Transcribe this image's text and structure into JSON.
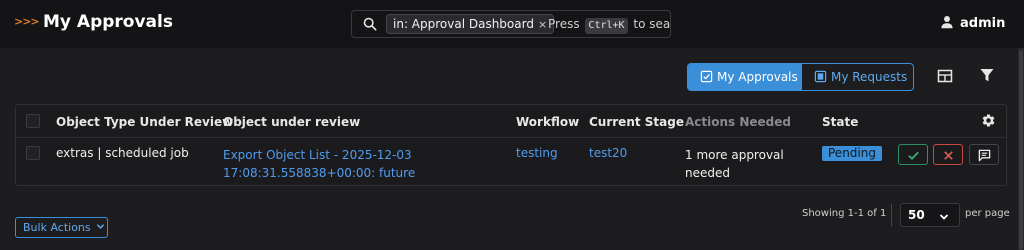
{
  "header": {
    "breadcrumb_chevrons": ">>>",
    "title": "My Approvals",
    "search": {
      "chip_label": "in: Approval Dashboard",
      "chip_close": "×",
      "hint_prefix": "Press",
      "shortcut": "Ctrl+K",
      "hint_suffix": "to search"
    },
    "user": {
      "name": "admin",
      "icon": "user-icon"
    }
  },
  "toolbar": {
    "tabs": [
      {
        "label": "My Approvals",
        "icon": "checklist-icon",
        "active": true
      },
      {
        "label": "My Requests",
        "icon": "request-icon",
        "active": false
      }
    ],
    "layout_icon": "layout-icon",
    "filter_icon": "filter-icon"
  },
  "table": {
    "columns": [
      "Object Type Under Review",
      "Object under review",
      "Workflow",
      "Current Stage",
      "Actions Needed",
      "State"
    ],
    "rows": [
      {
        "object_type": "extras | scheduled job",
        "object_line1": "Export Object List - 2025-12-03",
        "object_line2": "17:08:31.558838+00:00: future",
        "workflow": "testing",
        "current_stage": "test20",
        "actions_line1": "1 more approval",
        "actions_line2": "needed",
        "state": "Pending"
      }
    ]
  },
  "footer": {
    "bulk_actions": "Bulk Actions",
    "showing": "Showing 1-1 of 1",
    "per_page_value": "50",
    "per_page_label": "per page"
  },
  "colors": {
    "accent": "#3a8fd8",
    "link": "#4f9cf0",
    "approve": "#2f8f64",
    "reject": "#c64a44",
    "brand_chevron": "#d97c2b"
  }
}
